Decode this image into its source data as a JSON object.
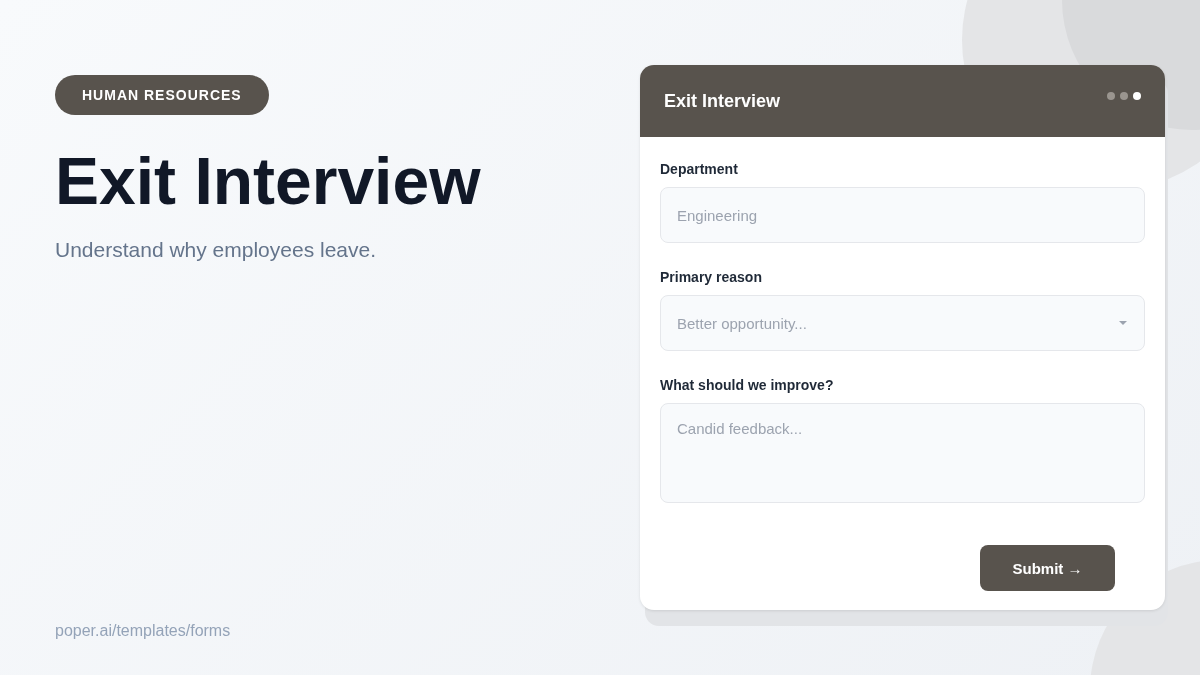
{
  "category_badge": "HUMAN RESOURCES",
  "headline": "Exit Interview",
  "subtitle": "Understand why employees leave.",
  "footer_link": "poper.ai/templates/forms",
  "form": {
    "title": "Exit Interview",
    "step_dots": [
      {
        "selected": false
      },
      {
        "selected": false
      },
      {
        "selected": true
      }
    ],
    "fields": [
      {
        "kind": "text",
        "label": "Department",
        "placeholder": "Engineering"
      },
      {
        "kind": "select",
        "label": "Primary reason",
        "placeholder": "Better opportunity..."
      },
      {
        "kind": "textarea",
        "label": "What should we improve?",
        "placeholder": "Candid feedback..."
      }
    ],
    "submit_button": "Submit →"
  }
}
